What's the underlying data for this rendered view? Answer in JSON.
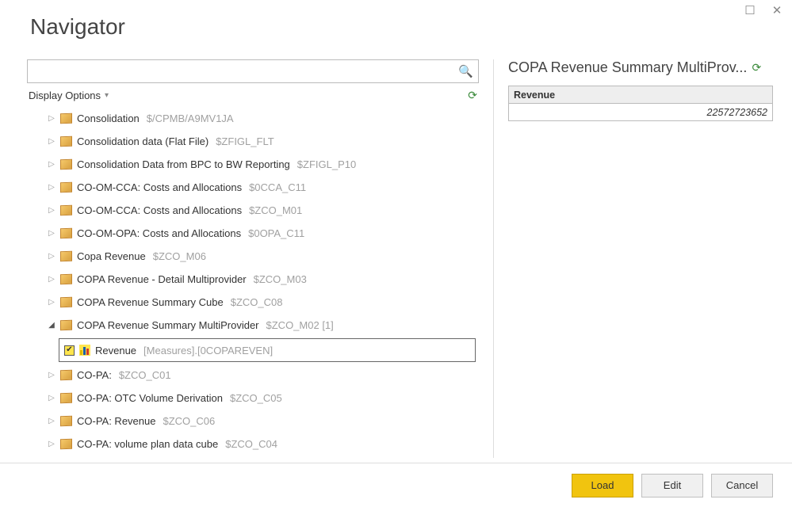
{
  "window": {
    "title": "Navigator",
    "display_options_label": "Display Options"
  },
  "search": {
    "text": ""
  },
  "tree": [
    {
      "label": "Consolidation",
      "code": "$/CPMB/A9MV1JA",
      "expanded": false
    },
    {
      "label": "Consolidation data (Flat File)",
      "code": "$ZFIGL_FLT",
      "expanded": false
    },
    {
      "label": "Consolidation Data from BPC to BW Reporting",
      "code": "$ZFIGL_P10",
      "expanded": false
    },
    {
      "label": "CO-OM-CCA: Costs and Allocations",
      "code": "$0CCA_C11",
      "expanded": false
    },
    {
      "label": "CO-OM-CCA: Costs and Allocations",
      "code": "$ZCO_M01",
      "expanded": false
    },
    {
      "label": "CO-OM-OPA: Costs and Allocations",
      "code": "$0OPA_C11",
      "expanded": false
    },
    {
      "label": "Copa Revenue",
      "code": "$ZCO_M06",
      "expanded": false
    },
    {
      "label": "COPA Revenue - Detail Multiprovider",
      "code": "$ZCO_M03",
      "expanded": false
    },
    {
      "label": "COPA Revenue Summary Cube",
      "code": "$ZCO_C08",
      "expanded": false
    },
    {
      "label": "COPA Revenue Summary MultiProvider",
      "code": "$ZCO_M02 [1]",
      "expanded": true,
      "children": [
        {
          "label": "Revenue",
          "code": "[Measures].[0COPAREVEN]",
          "checked": true
        }
      ]
    },
    {
      "label": "CO-PA:",
      "code": "$ZCO_C01",
      "expanded": false
    },
    {
      "label": "CO-PA: OTC Volume Derivation",
      "code": "$ZCO_C05",
      "expanded": false
    },
    {
      "label": "CO-PA: Revenue",
      "code": "$ZCO_C06",
      "expanded": false
    },
    {
      "label": "CO-PA: volume plan data cube",
      "code": "$ZCO_C04",
      "expanded": false
    }
  ],
  "preview": {
    "title": "COPA Revenue Summary MultiProv...",
    "columns": [
      "Revenue"
    ],
    "rows": [
      [
        "22572723652"
      ]
    ]
  },
  "footer": {
    "load": "Load",
    "edit": "Edit",
    "cancel": "Cancel"
  }
}
